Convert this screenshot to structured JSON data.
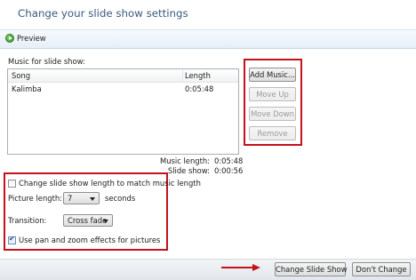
{
  "window": {
    "title": "Change your slide show settings"
  },
  "toolbar": {
    "preview_label": "Preview",
    "preview_icon": "play-icon"
  },
  "music": {
    "section_label": "Music for slide show:",
    "columns": [
      "Song",
      "Length"
    ],
    "rows": [
      {
        "song": "Kalimba",
        "length": "0:05:48"
      }
    ]
  },
  "buttons": {
    "add_music": "Add Music...",
    "move_up": "Move Up",
    "move_down": "Move Down",
    "remove": "Remove",
    "change_slide_show": "Change Slide Show",
    "dont_change": "Don't Change"
  },
  "stats": {
    "music_length_label": "Music length:",
    "music_length_value": "0:05:48",
    "slide_show_label": "Slide show:",
    "slide_show_value": "0:00:56"
  },
  "options": {
    "match_music_label": "Change slide show length to match music length",
    "match_music_checked": false,
    "picture_length_label": "Picture length:",
    "picture_length_value": "7",
    "picture_length_unit": "seconds",
    "transition_label": "Transition:",
    "transition_value": "Cross fade",
    "pan_zoom_label": "Use pan and zoom effects for pictures",
    "pan_zoom_checked": true
  },
  "colors": {
    "highlight": "#c4121c",
    "title": "#3b5a7a",
    "accent": "#2f8f23"
  }
}
